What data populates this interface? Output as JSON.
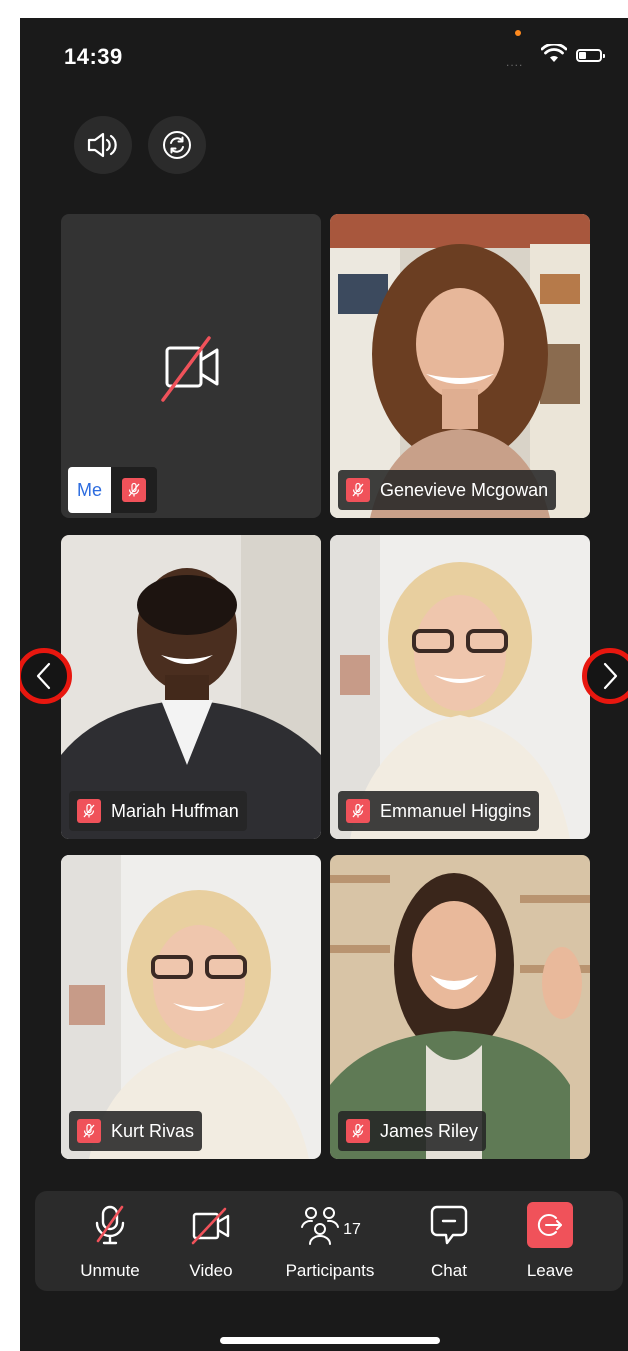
{
  "status_bar": {
    "time": "14:39",
    "signal": "....",
    "indicator_color": "#ff8a1e"
  },
  "top_controls": {
    "speaker_icon": "speaker-icon",
    "switch_camera_icon": "switch-camera-icon"
  },
  "participants": [
    {
      "name": "Me",
      "muted": true,
      "video": false,
      "self": true
    },
    {
      "name": "Genevieve Mcgowan",
      "muted": true,
      "video": true
    },
    {
      "name": "Mariah Huffman",
      "muted": true,
      "video": true
    },
    {
      "name": "Emmanuel Higgins",
      "muted": true,
      "video": true
    },
    {
      "name": "Kurt Rivas",
      "muted": true,
      "video": true
    },
    {
      "name": "James Riley",
      "muted": true,
      "video": true
    }
  ],
  "pager": {
    "prev_icon": "chevron-left-icon",
    "next_icon": "chevron-right-icon",
    "highlight_color": "#e8170f"
  },
  "toolbar": {
    "unmute_label": "Unmute",
    "video_label": "Video",
    "participants_label": "Participants",
    "participants_count": "17",
    "chat_label": "Chat",
    "leave_label": "Leave"
  },
  "colors": {
    "background": "#1a1a1a",
    "tile_bg": "#333333",
    "mute_badge": "#f0525a",
    "leave_button": "#f0525a",
    "me_label_text": "#2d6cdf"
  }
}
